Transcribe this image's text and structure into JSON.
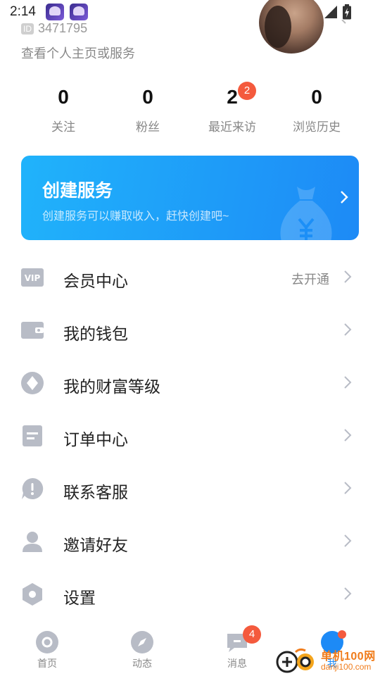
{
  "status_bar": {
    "time": "2:14",
    "app_icons": [
      "app-notification-icon",
      "app-notification-icon"
    ],
    "icons": [
      "wifi-icon",
      "cellular-signal-icon",
      "battery-charging-icon"
    ]
  },
  "profile": {
    "id_tag": "ID",
    "id_value": "3471795",
    "link_text": "查看个人主页或服务"
  },
  "stats": [
    {
      "value": "0",
      "label": "关注",
      "badge": ""
    },
    {
      "value": "0",
      "label": "粉丝",
      "badge": ""
    },
    {
      "value": "2",
      "label": "最近来访",
      "badge": "2"
    },
    {
      "value": "0",
      "label": "浏览历史",
      "badge": ""
    }
  ],
  "banner": {
    "title": "创建服务",
    "subtitle": "创建服务可以赚取收入，赶快创建吧~",
    "colors": {
      "start": "#20b3fb",
      "end": "#1d8af6"
    }
  },
  "menu": [
    {
      "icon": "vip-icon",
      "label": "会员中心",
      "extra": "去开通"
    },
    {
      "icon": "wallet-icon",
      "label": "我的钱包",
      "extra": ""
    },
    {
      "icon": "diamond-icon",
      "label": "我的财富等级",
      "extra": ""
    },
    {
      "icon": "order-icon",
      "label": "订单中心",
      "extra": ""
    },
    {
      "icon": "customer-service-icon",
      "label": "联系客服",
      "extra": ""
    },
    {
      "icon": "user-icon",
      "label": "邀请好友",
      "extra": ""
    },
    {
      "icon": "settings-icon",
      "label": "设置",
      "extra": ""
    }
  ],
  "bottom_nav": [
    {
      "icon": "home-icon",
      "label": "首页",
      "badge": "",
      "active": false
    },
    {
      "icon": "compass-icon",
      "label": "动态",
      "badge": "",
      "active": false
    },
    {
      "icon": "message-icon",
      "label": "消息",
      "badge": "4",
      "active": false
    },
    {
      "icon": "profile-icon",
      "label": "我",
      "badge": "",
      "active": true
    }
  ],
  "watermark": {
    "line1": "单机100网",
    "line2": "danji100.com"
  },
  "colors": {
    "accent": "#1d8af6",
    "badge": "#f45a3d",
    "icon_gray": "#b8bcc6",
    "watermark": "#f07c1b"
  }
}
